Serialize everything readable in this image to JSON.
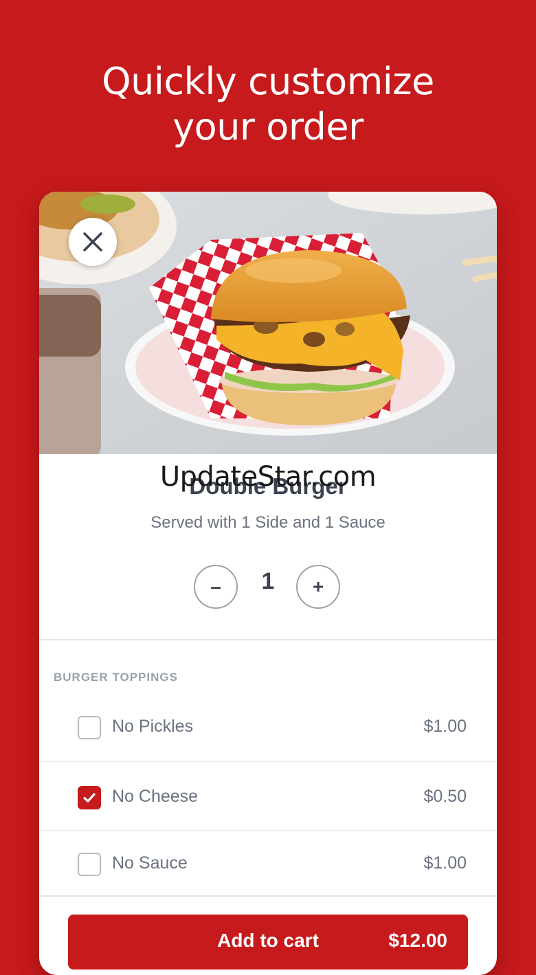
{
  "headline": {
    "line1": "Quickly customize",
    "line2": "your order"
  },
  "watermark": "UpdateStar.com",
  "item": {
    "title": "Double Burger",
    "subtitle": "Served with 1 Side and 1 Sauce",
    "quantity": "1",
    "minus_label": "–",
    "plus_label": "+"
  },
  "section": {
    "label": "BURGER TOPPINGS",
    "options": [
      {
        "name": "No Pickles",
        "price": "$1.00",
        "checked": false
      },
      {
        "name": "No Cheese",
        "price": "$0.50",
        "checked": true
      },
      {
        "name": "No Sauce",
        "price": "$1.00",
        "checked": false
      }
    ]
  },
  "cart": {
    "label": "Add to cart",
    "total": "$12.00"
  },
  "icons": {
    "close": "close-icon",
    "check": "check-icon"
  },
  "colors": {
    "brand": "#c61a1c",
    "text_dark": "#3b4250",
    "text_muted": "#6b7280"
  }
}
